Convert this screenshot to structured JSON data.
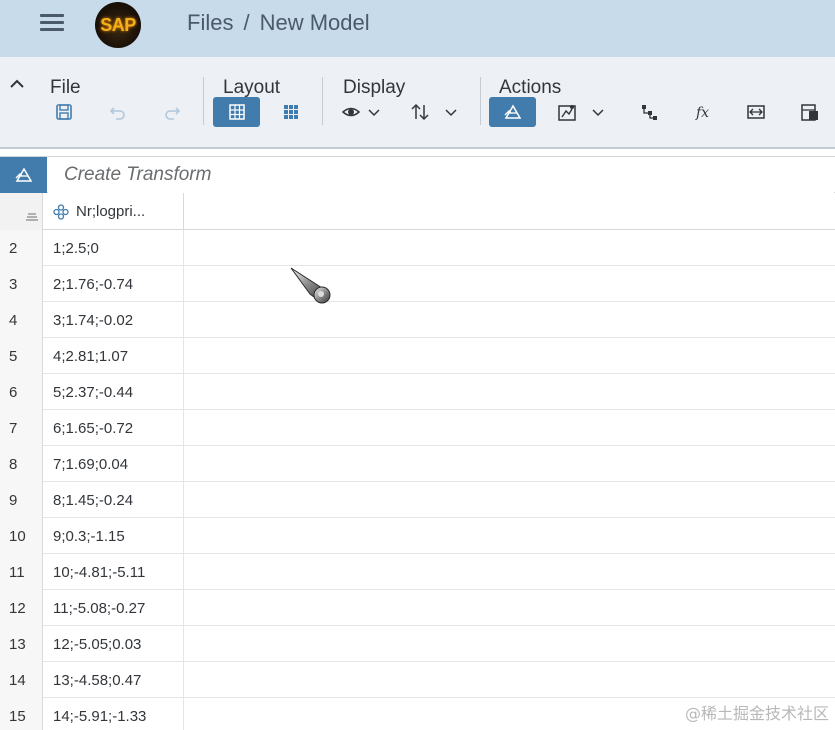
{
  "shell": {
    "logo_text": "SAP",
    "breadcrumb": [
      "Files",
      "/",
      "New Model"
    ]
  },
  "toolbar": {
    "groups": {
      "file": "File",
      "layout": "Layout",
      "display": "Display",
      "actions": "Actions"
    },
    "icons": {
      "file": [
        "save-icon",
        "undo-icon",
        "redo-icon"
      ],
      "layout": [
        "grid-view-icon",
        "card-view-icon"
      ],
      "display": [
        "eye-icon",
        "sort-icon"
      ],
      "actions": [
        "transform-icon",
        "smart-transform-icon",
        "hierarchy-icon",
        "formula-icon",
        "resize-icon",
        "details-icon"
      ]
    },
    "accent": "#427cac"
  },
  "transform": {
    "placeholder": "Create Transform"
  },
  "grid": {
    "column_header": "Nr;logpri...",
    "rows": [
      {
        "n": "2",
        "v": "1;2.5;0"
      },
      {
        "n": "3",
        "v": "2;1.76;-0.74"
      },
      {
        "n": "4",
        "v": "3;1.74;-0.02"
      },
      {
        "n": "5",
        "v": "4;2.81;1.07"
      },
      {
        "n": "6",
        "v": "5;2.37;-0.44"
      },
      {
        "n": "7",
        "v": "6;1.65;-0.72"
      },
      {
        "n": "8",
        "v": "7;1.69;0.04"
      },
      {
        "n": "9",
        "v": "8;1.45;-0.24"
      },
      {
        "n": "10",
        "v": "9;0.3;-1.15"
      },
      {
        "n": "11",
        "v": "10;-4.81;-5.11"
      },
      {
        "n": "12",
        "v": "11;-5.08;-0.27"
      },
      {
        "n": "13",
        "v": "12;-5.05;0.03"
      },
      {
        "n": "14",
        "v": "13;-4.58;0.47"
      },
      {
        "n": "15",
        "v": "14;-5.91;-1.33"
      }
    ]
  },
  "watermark": "@稀土掘金技术社区"
}
